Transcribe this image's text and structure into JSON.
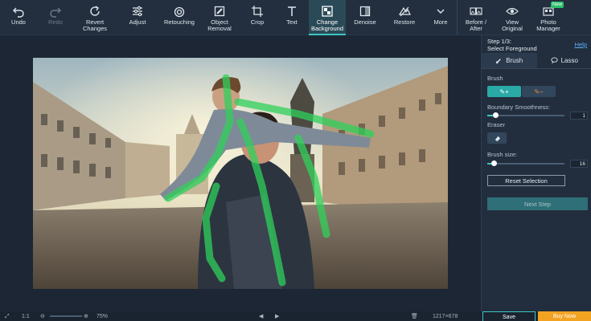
{
  "toolbar": {
    "undo": "Undo",
    "redo": "Redo",
    "revert": "Revert\nChanges",
    "adjust": "Adjust",
    "retouching": "Retouching",
    "object_removal": "Object\nRemoval",
    "crop": "Crop",
    "text": "Text",
    "change_background": "Change\nBackground",
    "denoise": "Denoise",
    "restore": "Restore",
    "more": "More",
    "before_after": "Before /\nAfter",
    "view_original": "View\nOriginal",
    "photo_manager": "Photo\nManager",
    "new_badge": "New"
  },
  "panel": {
    "step": "Step 1/3:",
    "step_name": "Select Foreground",
    "help": "Help",
    "tab_brush": "Brush",
    "tab_lasso": "Lasso",
    "brush_label": "Brush",
    "brush_add": "+",
    "brush_sub": "–",
    "boundary_label": "Boundary Smoothness:",
    "boundary_value": "1",
    "eraser_label": "Eraser",
    "brush_size_label": "Brush size:",
    "brush_size_value": "16",
    "reset": "Reset Selection",
    "next": "Next Step"
  },
  "sliders": {
    "boundary_fraction": 0.1,
    "brush_size_fraction": 0.08
  },
  "bottom": {
    "fit": "1:1",
    "zoom": "75%",
    "dimensions": "1217×678",
    "save": "Save",
    "buy": "Buy Now"
  },
  "colors": {
    "accent": "#3cc6c1",
    "buy": "#f3a322",
    "selection_stroke": "#2fd15a"
  }
}
